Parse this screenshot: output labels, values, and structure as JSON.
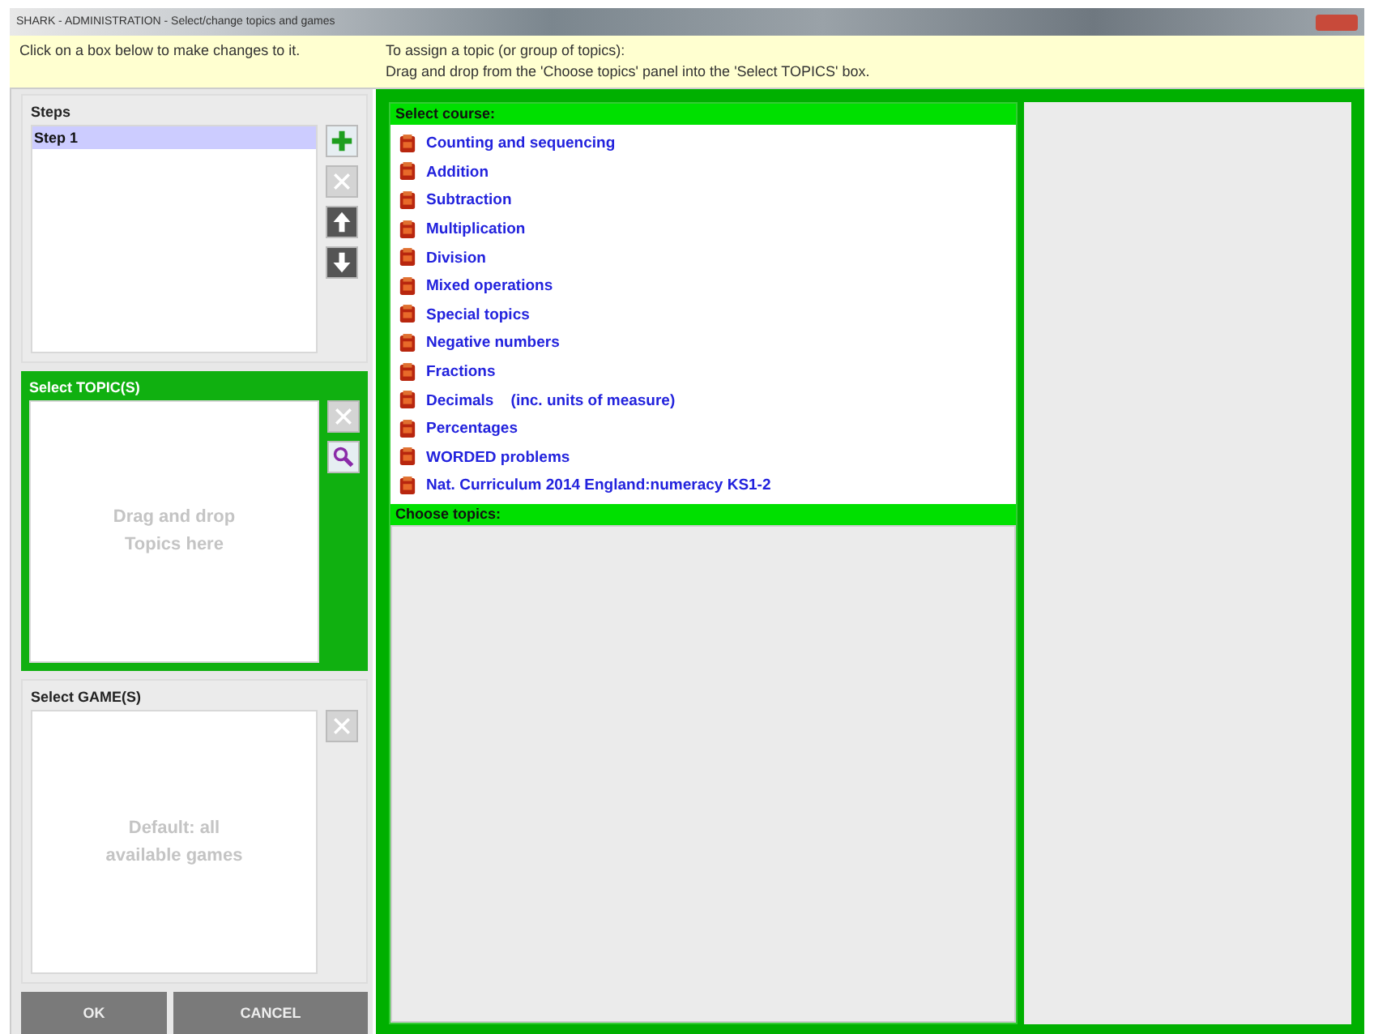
{
  "window": {
    "title": "SHARK - ADMINISTRATION - Select/change topics and games"
  },
  "info_bar": {
    "left": "Click on a box below to make changes to it.",
    "right": [
      "To assign a topic (or group of topics):",
      "Drag and drop from the 'Choose topics' panel into the 'Select TOPICS' box."
    ]
  },
  "steps": {
    "title": "Steps",
    "items": [
      {
        "label": "Step 1",
        "selected": true
      }
    ],
    "tools": [
      {
        "kind": "add",
        "disabled": false
      },
      {
        "kind": "delete",
        "disabled": true
      },
      {
        "kind": "up",
        "disabled": false
      },
      {
        "kind": "down",
        "disabled": false
      }
    ]
  },
  "topics": {
    "title": "Select TOPIC(S)",
    "placeholder": "Drag and drop Topics here",
    "tools": [
      {
        "kind": "delete",
        "disabled": true
      },
      {
        "kind": "search",
        "disabled": false
      }
    ]
  },
  "games": {
    "title": "Select GAME(S)",
    "placeholder": "Default: all available games",
    "tools": [
      {
        "kind": "delete",
        "disabled": true
      }
    ]
  },
  "buttons": [
    "OK",
    "CANCEL"
  ],
  "course": {
    "title": "Select course:",
    "items": [
      "Counting and sequencing",
      "Addition",
      "Subtraction",
      "Multiplication",
      "Division",
      "Mixed operations",
      "Special topics",
      "Negative numbers",
      "Fractions",
      "Decimals    (inc. units of measure)",
      "Percentages",
      "WORDED problems",
      "Nat. Curriculum 2014 England:numeracy KS1-2"
    ]
  },
  "choose": {
    "title": "Choose topics:"
  }
}
